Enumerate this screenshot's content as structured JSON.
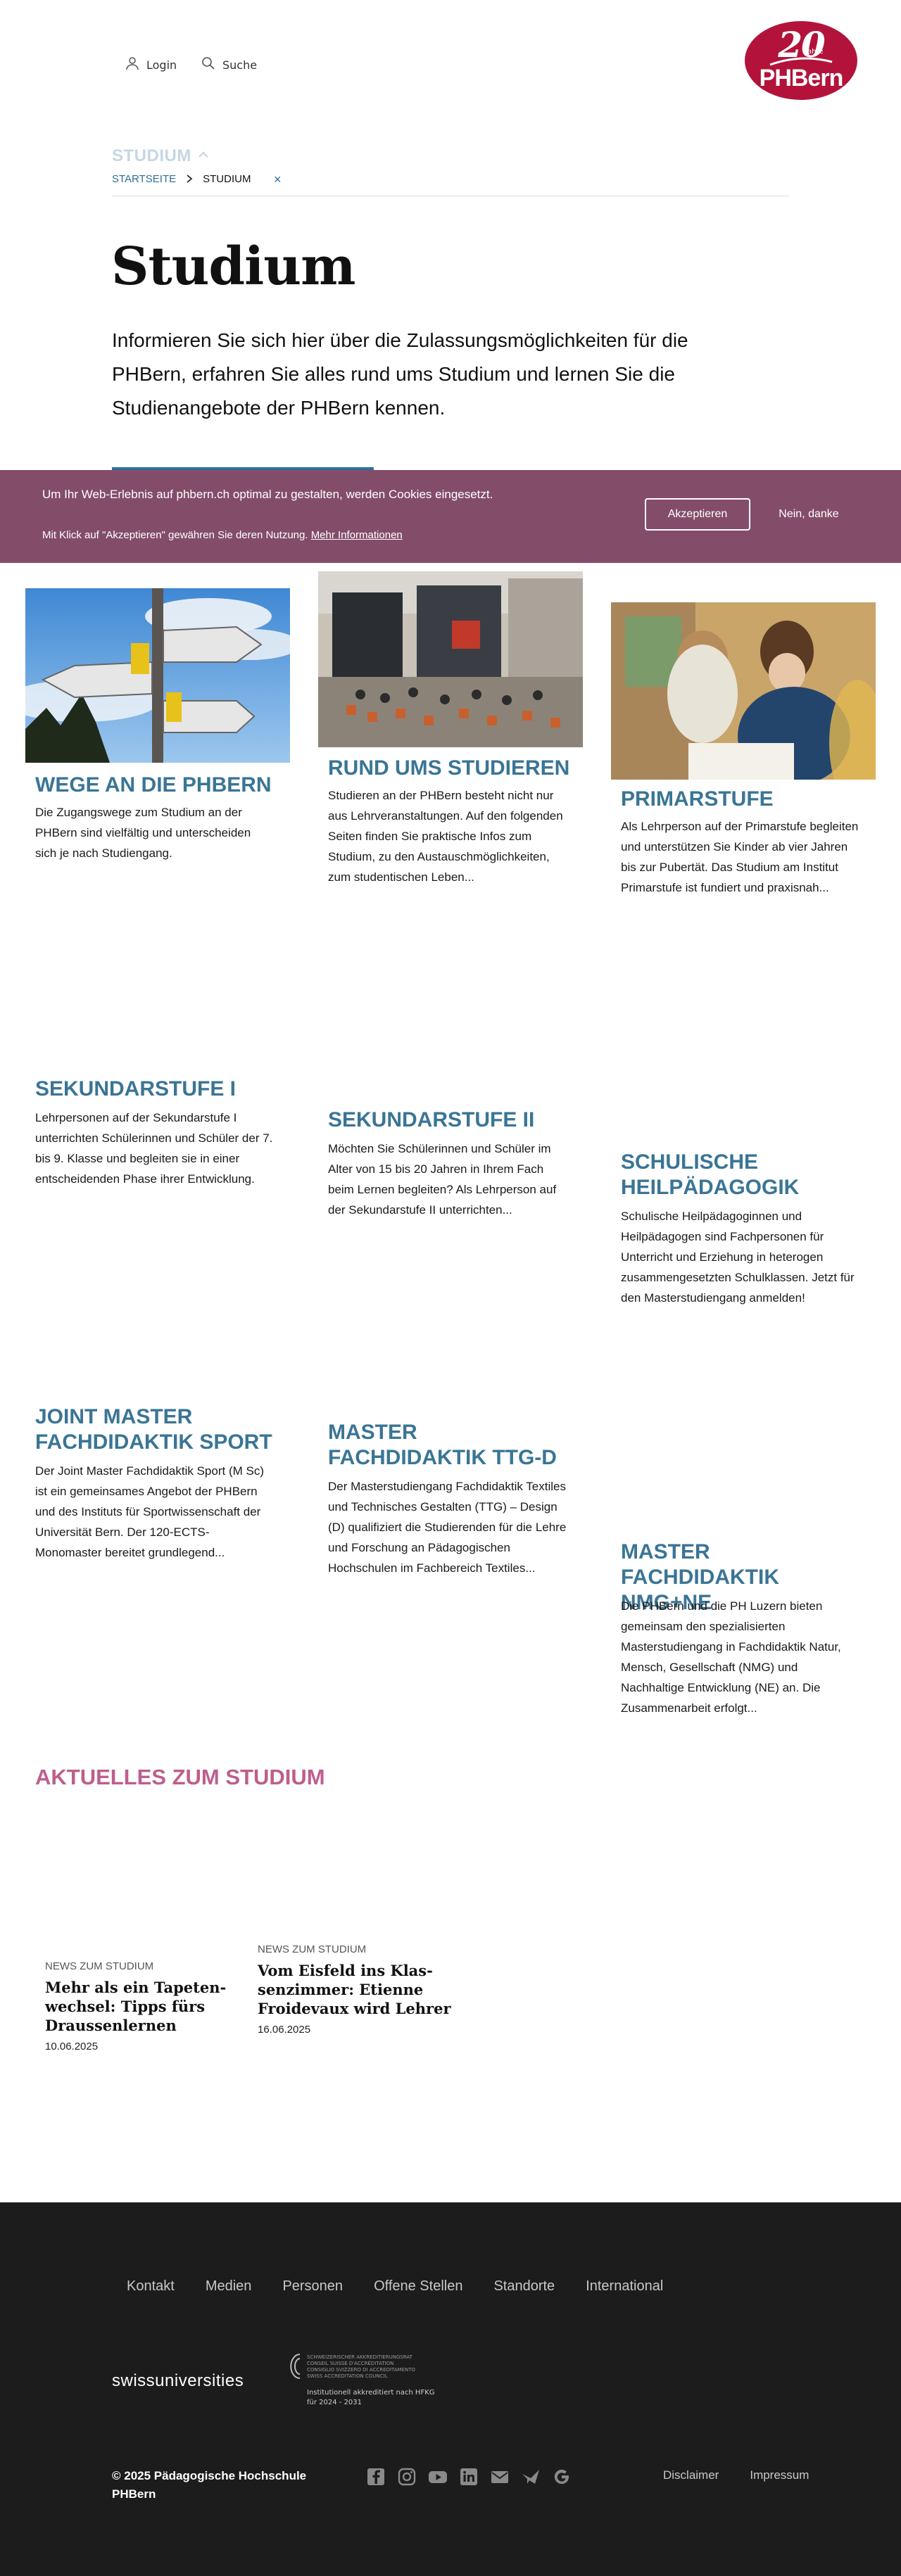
{
  "header": {
    "login_label": "Login",
    "search_label": "Suche",
    "logo": {
      "jahre_number": "20",
      "jahre_text": "Jahre",
      "brand": "PHBern",
      "color": "#b3133b"
    }
  },
  "breadcrumb": {
    "section_toggle": "STUDIUM",
    "home": "STARTSEITE",
    "current": "STUDIUM",
    "close_icon": "×"
  },
  "page": {
    "title": "Studium",
    "intro": "Informieren Sie sich hier über die Zulassungsmöglichkeiten für die PHBern, erfahren Sie alles rund ums Studium und lernen Sie die Studienangebote der PHBern kennen."
  },
  "cookie_banner": {
    "text": "Um Ihr Web-Erlebnis auf phbern.ch optimal zu gestalten, werden Cookies eingesetzt.",
    "small_text": "Mit Klick auf \"Akzeptieren\" gewähren Sie deren Nutzung.",
    "more_link": "Mehr Informationen",
    "accept_label": "Akzeptieren",
    "decline_label": "Nein, danke",
    "background": "#834d6a"
  },
  "cards": [
    {
      "title": "WEGE AN DIE PHBERN",
      "text": "Die Zugangswege zum Studium an der PHBern sind vielfältig und unterscheiden sich je nach Studiengang."
    },
    {
      "title": "RUND UMS STUDIEREN",
      "text": "Studieren an der PHBern besteht nicht nur aus Lehrveranstaltungen. Auf den folgenden Seiten finden Sie praktische Infos zum Studium, zu den Austauschmöglichkeiten, zum studentischen Leben..."
    },
    {
      "title": "PRIMARSTUFE",
      "text": "Als Lehrperson auf der Primarstufe begleiten und unterstützen Sie Kinder ab vier Jahren bis zur Pubertät. Das Studium am Institut Primarstufe ist fundiert und praxisnah..."
    },
    {
      "title": "SEKUNDARSTUFE I",
      "text": "Lehrpersonen auf der Sekundarstufe I unterrichten Schülerinnen und Schüler der 7. bis 9. Klasse und begleiten sie in einer entscheidenden Phase ihrer Entwicklung."
    },
    {
      "title": "SEKUNDARSTUFE II",
      "text": "Möchten Sie Schülerinnen und Schüler im Alter von 15 bis 20 Jahren in Ihrem Fach beim Lernen begleiten? Als Lehrperson auf der Sekundarstufe II unterrichten..."
    },
    {
      "title": "SCHULISCHE HEILPÄDAGOGIK",
      "text": "Schulische Heilpädagoginnen und Heilpädagogen sind Fachpersonen für Unterricht und Erziehung in heterogen zusammengesetzten Schulklassen. Jetzt für den Masterstudiengang anmelden!"
    },
    {
      "title": "JOINT MASTER FACHDI­DAKTIK SPORT",
      "text": "Der Joint Master Fachdidaktik Sport (M Sc) ist ein gemeinsames Angebot der PHBern und des Instituts für Sportwissenschaft der Universität Bern. Der 120-ECTS-Monomaster bereitet grundlegend..."
    },
    {
      "title": "MASTER FACHDIDAKTIK TTG-D",
      "text": "Der Masterstudiengang Fachdidaktik Textiles und Technisches Gestalten (TTG) – Design (D) qualifiziert die Studierenden für die Lehre und Forschung an Pädagogischen Hochschulen im Fachbereich Textiles..."
    },
    {
      "title": "MASTER FACHDIDAKTIK NMG+NE",
      "text": "Die PHBern und die PH Luzern bieten gemeinsam den spezialisierten Masterstudiengang in Fachdidaktik Natur, Mensch, Gesellschaft (NMG) und Nachhaltige Entwicklung (NE) an. Die Zusammenarbeit erfolgt..."
    }
  ],
  "news_section": {
    "heading": "AKTUELLES ZUM STUDIUM",
    "items": [
      {
        "kicker": "NEWS ZUM STUDIUM",
        "title": "Mehr als ein Tapeten-wechsel: Tipps fürs Draussenlernen",
        "date": "10.06.2025"
      },
      {
        "kicker": "NEWS ZUM STUDIUM",
        "title": "Vom Eisfeld ins Klas-senzimmer: Etienne Froidevaux wird Lehrer",
        "date": "16.06.2025"
      }
    ]
  },
  "footer": {
    "nav": [
      "Kontakt",
      "Medien",
      "Personen",
      "Offene Stellen",
      "Standorte",
      "International"
    ],
    "swissuniversities": "swissuniversities",
    "accreditation_lines": [
      "SCHWEIZERISCHER AKKREDITIERUNGSRAT",
      "CONSEIL SUISSE D'ACCRÉDITATION",
      "CONSIGLIO SVIZZERO DI ACCREDITAMENTO",
      "SWISS ACCREDITATION COUNCIL"
    ],
    "accreditation_inst": "Institutionell akkreditiert nach HFKG für 2024 - 2031",
    "copyright_line1": "© 2025 Pädagogische Hochschule",
    "copyright_line2": "PHBern",
    "social_icons": [
      "facebook-icon",
      "instagram-icon",
      "youtube-icon",
      "linkedin-icon",
      "mail-icon",
      "newsletter-icon",
      "google-icon"
    ],
    "legal": [
      "Disclaimer",
      "Impressum"
    ]
  }
}
